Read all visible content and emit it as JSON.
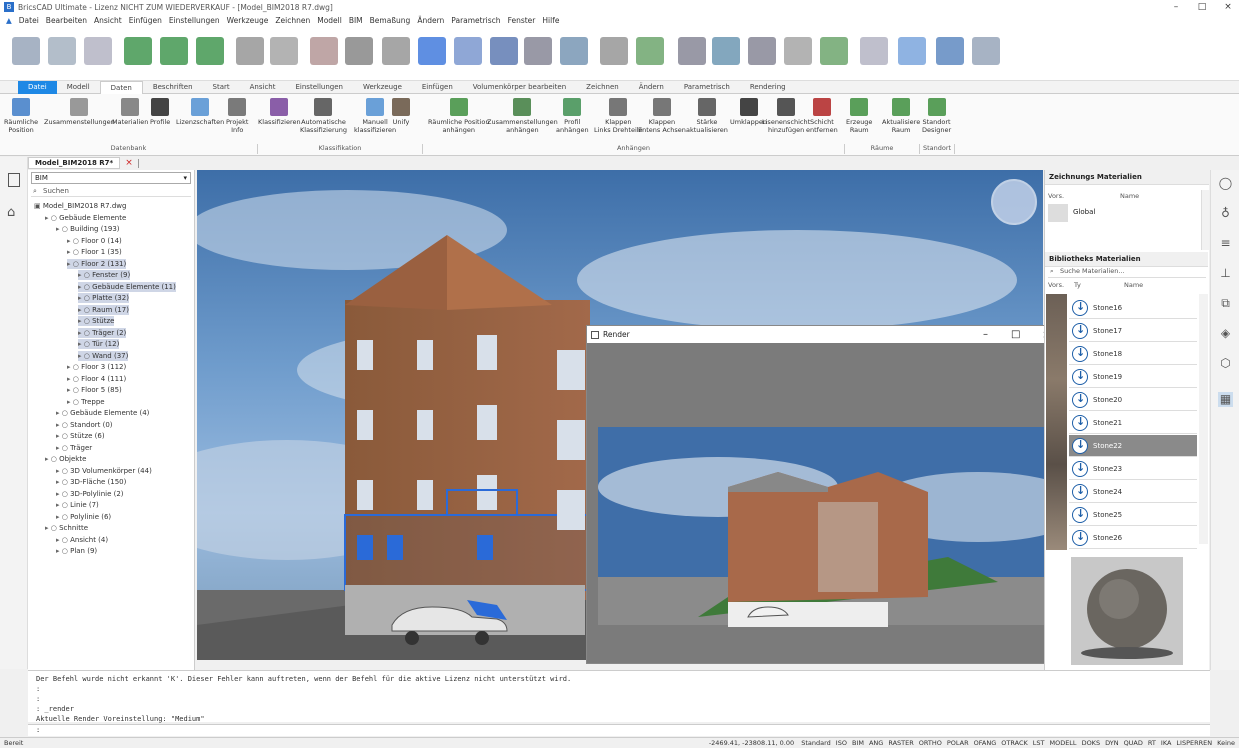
{
  "titlebar": {
    "title": "BricsCAD Ultimate - Lizenz NICHT ZUM WIEDERVERKAUF - [Model_BIM2018 R7.dwg]",
    "minimize": "–",
    "maximize": "□",
    "close": "×"
  },
  "menu": [
    "Datei",
    "Bearbeiten",
    "Ansicht",
    "Einfügen",
    "Einstellungen",
    "Werkzeuge",
    "Zeichnen",
    "Modell",
    "BIM",
    "Bemaßung",
    "Ändern",
    "Parametrisch",
    "Fenster",
    "Hilfe"
  ],
  "tabs": [
    "Datei",
    "Modell",
    "Daten",
    "Beschriften",
    "Start",
    "Ansicht",
    "Einstellungen",
    "Werkzeuge",
    "Einfügen",
    "Volumenkörper bearbeiten",
    "Zeichnen",
    "Ändern",
    "Parametrisch",
    "Rendering"
  ],
  "ribbon": {
    "groups": [
      "Datenbank",
      "Klassifikation",
      "Anhängen",
      "Räume",
      "Standort"
    ],
    "buttons": [
      {
        "label": "Räumliche\nPosition",
        "color": "#5a8fcf"
      },
      {
        "label": "Zusammenstellungen",
        "color": "#999"
      },
      {
        "label": "Materialien",
        "color": "#888"
      },
      {
        "label": "Profile",
        "color": "#444"
      },
      {
        "label": "Lizenzschaften",
        "color": "#6aa0d8"
      },
      {
        "label": "Projekt\nInfo",
        "color": "#7a7a7a"
      },
      {
        "label": "Klassifizieren",
        "color": "#8a5ea8"
      },
      {
        "label": "Automatische\nKlassifizierung",
        "color": "#666"
      },
      {
        "label": "Manuell\nklassifizieren",
        "color": "#6aa0d8"
      },
      {
        "label": "Unify",
        "color": "#7a6a5a"
      },
      {
        "label": "Räumliche Position\nanhängen",
        "color": "#5a9f5a"
      },
      {
        "label": "Zusammenstellungen\nanhängen",
        "color": "#5a8f5a"
      },
      {
        "label": "Profil\nanhängen",
        "color": "#5a9f6a"
      },
      {
        "label": "Klappen\nLinks Drehteile",
        "color": "#777"
      },
      {
        "label": "Klappen\nEntens Achsen",
        "color": "#777"
      },
      {
        "label": "Stärke\naktualisieren",
        "color": "#666"
      },
      {
        "label": "Umklappen",
        "color": "#444"
      },
      {
        "label": "Lisenenschicht\nhinzufügen",
        "color": "#555"
      },
      {
        "label": "Schicht\nentfernen",
        "color": "#b44"
      },
      {
        "label": "Erzeuge\nRaum",
        "color": "#5a9f5a"
      },
      {
        "label": "Aktualisiere\nRaum",
        "color": "#5a9f5a"
      },
      {
        "label": "Standort\nDesigner",
        "color": "#5a9f5a"
      }
    ]
  },
  "doctab": {
    "name": "Model_BIM2018 R7*",
    "close": "×"
  },
  "tree": {
    "combo": "BIM",
    "search": "Suchen",
    "nodes": [
      {
        "text": "Model_BIM2018 R7.dwg",
        "level": 0
      },
      {
        "text": "Gebäude Elemente",
        "level": 1
      },
      {
        "text": "Building (193)",
        "level": 2
      },
      {
        "text": "Floor 0 (14)",
        "level": 3
      },
      {
        "text": "Floor 1 (35)",
        "level": 3
      },
      {
        "text": "Floor 2 (131)",
        "level": 3,
        "hl": true
      },
      {
        "text": "Fenster (9)",
        "level": 4,
        "hl": true
      },
      {
        "text": "Gebäude Elemente (11)",
        "level": 4,
        "hl": true
      },
      {
        "text": "Platte (32)",
        "level": 4,
        "hl": true
      },
      {
        "text": "Raum (17)",
        "level": 4,
        "hl": true
      },
      {
        "text": "Stütze",
        "level": 4,
        "hl": true
      },
      {
        "text": "Träger (2)",
        "level": 4,
        "hl": true
      },
      {
        "text": "Tür (12)",
        "level": 4,
        "hl": true
      },
      {
        "text": "Wand (37)",
        "level": 4,
        "hl": true
      },
      {
        "text": "Floor 3 (112)",
        "level": 3
      },
      {
        "text": "Floor 4 (111)",
        "level": 3
      },
      {
        "text": "Floor 5 (85)",
        "level": 3
      },
      {
        "text": "Treppe",
        "level": 3
      },
      {
        "text": "Gebäude Elemente (4)",
        "level": 2
      },
      {
        "text": "Standort (0)",
        "level": 2
      },
      {
        "text": "Stütze (6)",
        "level": 2
      },
      {
        "text": "Träger",
        "level": 2
      },
      {
        "text": "Objekte",
        "level": 1
      },
      {
        "text": "3D Volumenkörper (44)",
        "level": 2
      },
      {
        "text": "3D-Fläche (150)",
        "level": 2
      },
      {
        "text": "3D-Polylinie (2)",
        "level": 2
      },
      {
        "text": "Linie (7)",
        "level": 2
      },
      {
        "text": "Polylinie (6)",
        "level": 2
      },
      {
        "text": "Schnitte",
        "level": 1
      },
      {
        "text": "Ansicht (4)",
        "level": 2
      },
      {
        "text": "Plan (9)",
        "level": 2
      }
    ]
  },
  "render": {
    "title": "Render"
  },
  "materials": {
    "drawing_header": "Zeichnungs Materialien",
    "col_name": "Name",
    "col_vorsch": "Vors.",
    "drawing_item": "Global",
    "library_header": "Bibliotheks Materialien",
    "search": "Suche Materialien...",
    "col_ty": "Ty",
    "items": [
      {
        "name": "Stone16",
        "sel": false
      },
      {
        "name": "Stone17",
        "sel": false
      },
      {
        "name": "Stone18",
        "sel": false
      },
      {
        "name": "Stone19",
        "sel": false
      },
      {
        "name": "Stone20",
        "sel": false
      },
      {
        "name": "Stone21",
        "sel": false
      },
      {
        "name": "Stone22",
        "sel": true
      },
      {
        "name": "Stone23",
        "sel": false
      },
      {
        "name": "Stone24",
        "sel": false
      },
      {
        "name": "Stone25",
        "sel": false
      },
      {
        "name": "Stone26",
        "sel": false
      }
    ]
  },
  "command": {
    "lines": [
      "Der Befehl wurde nicht erkannt 'K'. Dieser Fehler kann auftreten, wenn der Befehl für die aktive Lizenz nicht unterstützt wird.",
      ":",
      ":",
      ": _render",
      "Aktuelle Render Voreinstellung: \"Medium\""
    ],
    "prompt": ":"
  },
  "status": {
    "ready": "Bereit",
    "coords": "-2469.41, -23808.11, 0.00",
    "items": [
      "Standard",
      "ISO",
      "BIM",
      "ANG",
      "RASTER",
      "ORTHO",
      "POLAR",
      "OFANG",
      "OTRACK",
      "LST",
      "MODELL",
      "DOKS",
      "DYN",
      "QUAD",
      "RT",
      "IKA",
      "LISPERREN",
      "Keine"
    ]
  }
}
